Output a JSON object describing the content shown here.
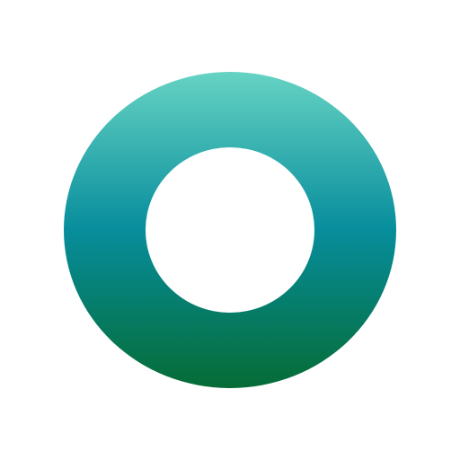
{
  "icon": {
    "name": "ring-logo-icon",
    "gradient": {
      "top_color": "#66d3c3",
      "mid_color": "#078d9c",
      "bottom_color": "#056c36"
    },
    "hole_color": "#ffffff"
  },
  "background_color": "#ffffff"
}
